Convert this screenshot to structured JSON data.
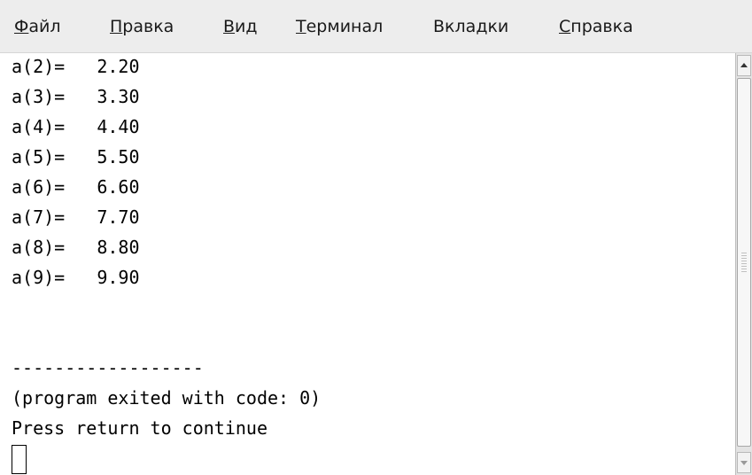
{
  "menubar": {
    "items": [
      {
        "mnemonic": "Ф",
        "rest": "айл"
      },
      {
        "mnemonic": "П",
        "rest": "равка"
      },
      {
        "mnemonic": "В",
        "rest": "ид"
      },
      {
        "mnemonic": "Т",
        "rest": "ерминал"
      },
      {
        "pre": "Вкла",
        "mnemonic": "д",
        "rest": "ки"
      },
      {
        "mnemonic": "С",
        "rest": "правка"
      }
    ]
  },
  "terminal": {
    "lines": [
      "a(2)=   2.20",
      "a(3)=   3.30",
      "a(4)=   4.40",
      "a(5)=   5.50",
      "a(6)=   6.60",
      "a(7)=   7.70",
      "a(8)=   8.80",
      "a(9)=   9.90",
      "",
      "",
      "------------------",
      "(program exited with code: 0)",
      "Press return to continue"
    ]
  },
  "icons": {
    "scroll_up": "arrow-up-icon",
    "scroll_down": "arrow-down-icon"
  }
}
